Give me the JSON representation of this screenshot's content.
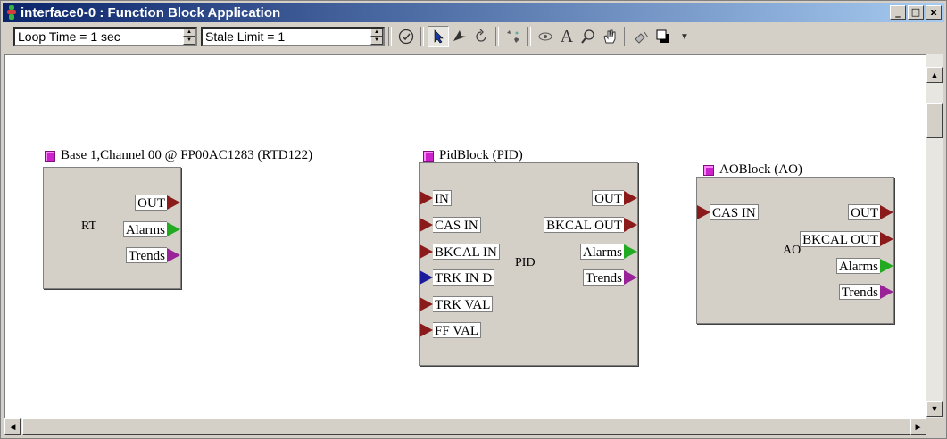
{
  "window": {
    "title": "interface0-0 : Function Block Application"
  },
  "title_controls": {
    "minimize": "_",
    "restore": "□",
    "close": "x"
  },
  "toolbar": {
    "loop_time": "Loop Time = 1 sec",
    "stale_limit": "Stale Limit = 1",
    "tools": [
      "check-icon",
      "pointer-icon",
      "connect-icon",
      "rotate-icon",
      "sparkle-icon",
      "eye-icon",
      "text-icon",
      "zoom-icon",
      "hand-icon",
      "paint-icon",
      "fill-color-icon",
      "dropdown-icon"
    ]
  },
  "blocks": {
    "rtd": {
      "title": "Base 1,Channel 00 @ FP00AC1283 (RTD122)",
      "type_label": "RT",
      "outputs": [
        "OUT",
        "Alarms",
        "Trends"
      ]
    },
    "pid": {
      "title": "PidBlock (PID)",
      "type_label": "PID",
      "inputs": [
        "IN",
        "CAS IN",
        "BKCAL IN",
        "TRK IN D",
        "TRK VAL",
        "FF VAL"
      ],
      "outputs": [
        "OUT",
        "BKCAL OUT",
        "Alarms",
        "Trends"
      ]
    },
    "ao": {
      "title": "AOBlock (AO)",
      "type_label": "AO",
      "inputs": [
        "CAS IN"
      ],
      "outputs": [
        "OUT",
        "BKCAL OUT",
        "Alarms",
        "Trends"
      ]
    }
  },
  "colors": {
    "titlebar_start": "#0a246a",
    "titlebar_end": "#a6caf0",
    "port_red": "#8b1a1a",
    "port_green": "#22aa22",
    "port_purple": "#992299",
    "port_blue": "#1a1a9b"
  }
}
